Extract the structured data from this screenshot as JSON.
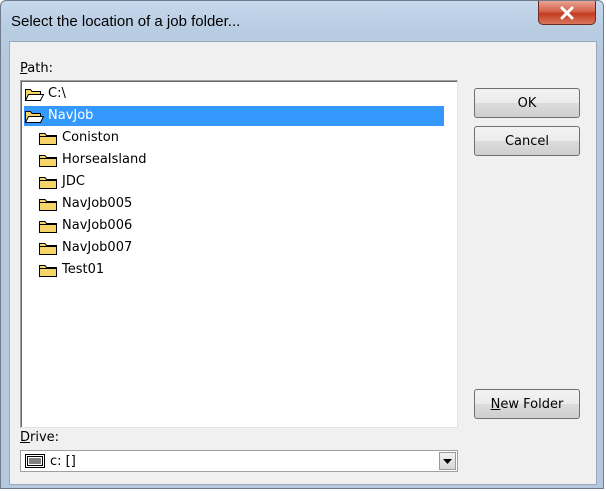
{
  "window": {
    "title": "Select the location of a job folder...",
    "close_glyph": "X"
  },
  "path": {
    "label": "Path:",
    "access_key": "P",
    "label_rest": "ath:",
    "items": [
      {
        "name": "C:\\",
        "icon": "open-folder-icon",
        "selected": false,
        "indent": 0
      },
      {
        "name": "NavJob",
        "icon": "open-folder-icon",
        "selected": true,
        "indent": 0
      },
      {
        "name": "Coniston",
        "icon": "folder-icon",
        "selected": false,
        "indent": 1
      },
      {
        "name": "HorseaIsland",
        "icon": "folder-icon",
        "selected": false,
        "indent": 1
      },
      {
        "name": "JDC",
        "icon": "folder-icon",
        "selected": false,
        "indent": 1
      },
      {
        "name": "NavJob005",
        "icon": "folder-icon",
        "selected": false,
        "indent": 1
      },
      {
        "name": "NavJob006",
        "icon": "folder-icon",
        "selected": false,
        "indent": 1
      },
      {
        "name": "NavJob007",
        "icon": "folder-icon",
        "selected": false,
        "indent": 1
      },
      {
        "name": "Test01",
        "icon": "folder-icon",
        "selected": false,
        "indent": 1
      }
    ]
  },
  "buttons": {
    "ok": "OK",
    "cancel": "Cancel",
    "new_folder_key": "N",
    "new_folder_rest": "ew Folder"
  },
  "drive": {
    "label_key": "D",
    "label_rest": "rive:",
    "value": "c: []",
    "icon": "drive-icon"
  },
  "colors": {
    "selection": "#3399ff",
    "folder": "#f5d468",
    "close_button": "#c43b22"
  }
}
